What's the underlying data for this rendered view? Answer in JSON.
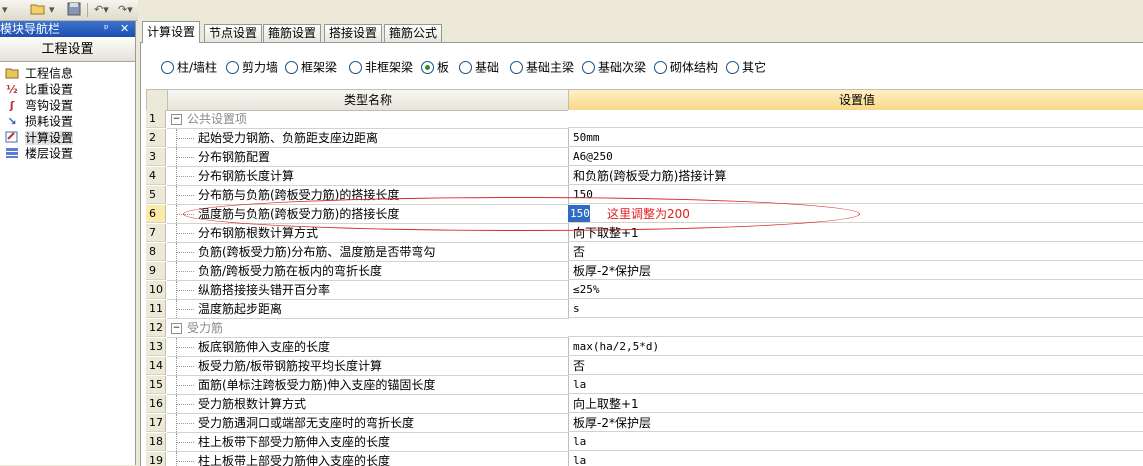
{
  "toolbar": {
    "icons": [
      "open-folder-icon",
      "save-icon",
      "undo-icon",
      "redo-icon"
    ]
  },
  "nav": {
    "title": "模块导航栏",
    "pin_glyph": "ᵖ",
    "close_glyph": "✕",
    "group": "工程设置",
    "items": [
      {
        "label": "工程信息",
        "icon": "project-info-icon"
      },
      {
        "label": "比重设置",
        "icon": "density-icon"
      },
      {
        "label": "弯钩设置",
        "icon": "hook-icon"
      },
      {
        "label": "损耗设置",
        "icon": "loss-icon"
      },
      {
        "label": "计算设置",
        "icon": "calc-settings-icon",
        "selected": true
      },
      {
        "label": "楼层设置",
        "icon": "floors-icon"
      }
    ]
  },
  "tabs": [
    "计算设置",
    "节点设置",
    "箍筋设置",
    "搭接设置",
    "箍筋公式"
  ],
  "radios": [
    {
      "label": "柱/墙柱",
      "checked": false
    },
    {
      "label": "剪力墙",
      "checked": false
    },
    {
      "label": "框架梁",
      "checked": false
    },
    {
      "label": "非框架梁",
      "checked": false
    },
    {
      "label": "板",
      "checked": true
    },
    {
      "label": "基础",
      "checked": false
    },
    {
      "label": "基础主梁",
      "checked": false
    },
    {
      "label": "基础次梁",
      "checked": false
    },
    {
      "label": "砌体结构",
      "checked": false
    },
    {
      "label": "其它",
      "checked": false
    }
  ],
  "grid": {
    "col_name": "类型名称",
    "col_value": "设置值",
    "rows": [
      {
        "n": "1",
        "name": "公共设置项",
        "value": "",
        "group": true
      },
      {
        "n": "2",
        "name": "起始受力钢筋、负筋距支座边距离",
        "value": "50mm"
      },
      {
        "n": "3",
        "name": "分布钢筋配置",
        "value": "A6@250"
      },
      {
        "n": "4",
        "name": "分布钢筋长度计算",
        "value": "和负筋(跨板受力筋)搭接计算",
        "cn": true
      },
      {
        "n": "5",
        "name": "分布筋与负筋(跨板受力筋)的搭接长度",
        "value": "150"
      },
      {
        "n": "6",
        "name": "温度筋与负筋(跨板受力筋)的搭接长度",
        "value": "150",
        "current": true
      },
      {
        "n": "7",
        "name": "分布钢筋根数计算方式",
        "value": "向下取整+1",
        "cn": true
      },
      {
        "n": "8",
        "name": "负筋(跨板受力筋)分布筋、温度筋是否带弯勾",
        "value": "否",
        "cn": true
      },
      {
        "n": "9",
        "name": "负筋/跨板受力筋在板内的弯折长度",
        "value": "板厚-2*保护层",
        "cn": true
      },
      {
        "n": "10",
        "name": "纵筋搭接接头错开百分率",
        "value": "≤25%"
      },
      {
        "n": "11",
        "name": "温度筋起步距离",
        "value": "s"
      },
      {
        "n": "12",
        "name": "受力筋",
        "value": "",
        "group": true
      },
      {
        "n": "13",
        "name": "板底钢筋伸入支座的长度",
        "value": "max(ha/2,5*d)"
      },
      {
        "n": "14",
        "name": "板受力筋/板带钢筋按平均长度计算",
        "value": "否",
        "cn": true
      },
      {
        "n": "15",
        "name": "面筋(单标注跨板受力筋)伸入支座的锚固长度",
        "value": "la"
      },
      {
        "n": "16",
        "name": "受力筋根数计算方式",
        "value": "向上取整+1",
        "cn": true
      },
      {
        "n": "17",
        "name": "受力筋遇洞口或端部无支座时的弯折长度",
        "value": "板厚-2*保护层",
        "cn": true
      },
      {
        "n": "18",
        "name": "柱上板带下部受力筋伸入支座的长度",
        "value": "la"
      },
      {
        "n": "19",
        "name": "柱上板带上部受力筋伸入支座的长度",
        "value": "la"
      }
    ]
  },
  "annotation": {
    "text": "这里调整为200",
    "color": "#e02020"
  }
}
